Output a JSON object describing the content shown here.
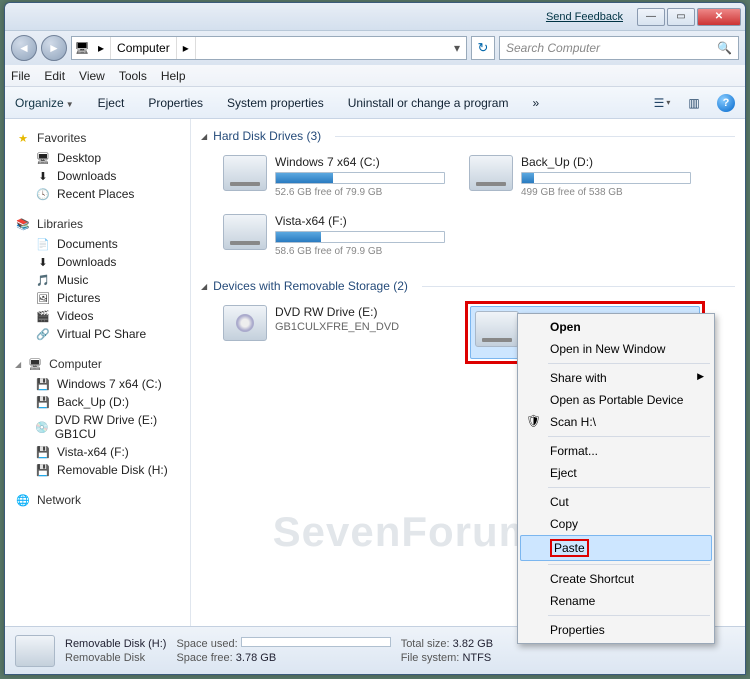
{
  "titlebar": {
    "feedback": "Send Feedback"
  },
  "address": {
    "crumb": "Computer",
    "arrow": "▸"
  },
  "search": {
    "placeholder": "Search Computer"
  },
  "menubar": [
    "File",
    "Edit",
    "View",
    "Tools",
    "Help"
  ],
  "toolbar": {
    "organize": "Organize",
    "items": [
      "Eject",
      "Properties",
      "System properties",
      "Uninstall or change a program"
    ],
    "overflow": "»"
  },
  "sidebar": {
    "favorites": {
      "label": "Favorites",
      "items": [
        "Desktop",
        "Downloads",
        "Recent Places"
      ]
    },
    "libraries": {
      "label": "Libraries",
      "items": [
        "Documents",
        "Downloads",
        "Music",
        "Pictures",
        "Videos",
        "Virtual PC Share"
      ]
    },
    "computer": {
      "label": "Computer",
      "items": [
        "Windows 7 x64 (C:)",
        "Back_Up (D:)",
        "DVD RW Drive (E:) GB1CU",
        "Vista-x64 (F:)",
        "Removable Disk (H:)"
      ]
    },
    "network": {
      "label": "Network"
    }
  },
  "groups": {
    "hdd": {
      "label": "Hard Disk Drives (3)"
    },
    "rem": {
      "label": "Devices with Removable Storage (2)"
    }
  },
  "drives": {
    "c": {
      "name": "Windows 7 x64 (C:)",
      "free": "52.6 GB free of 79.9 GB",
      "pct": 34
    },
    "d": {
      "name": "Back_Up (D:)",
      "free": "499 GB free of 538 GB",
      "pct": 7
    },
    "f": {
      "name": "Vista-x64 (F:)",
      "free": "58.6 GB free of 79.9 GB",
      "pct": 27
    },
    "e": {
      "name": "DVD RW Drive (E:)",
      "sub": "GB1CULXFRE_EN_DVD"
    },
    "h": {
      "name": "Removable Disk (H:)",
      "free": "3.78 GB free of 3.82 GB",
      "pct": 2
    }
  },
  "context": {
    "open": "Open",
    "newwin": "Open in New Window",
    "share": "Share with",
    "portable": "Open as Portable Device",
    "scan": "Scan H:\\",
    "format": "Format...",
    "eject": "Eject",
    "cut": "Cut",
    "copy": "Copy",
    "paste": "Paste",
    "shortcut": "Create Shortcut",
    "rename": "Rename",
    "props": "Properties"
  },
  "status": {
    "name": "Removable Disk (H:)",
    "sub": "Removable Disk",
    "used_lbl": "Space used:",
    "free_lbl": "Space free:",
    "free_val": "3.78 GB",
    "total_lbl": "Total size:",
    "total_val": "3.82 GB",
    "fs_lbl": "File system:",
    "fs_val": "NTFS"
  },
  "watermark": "SevenForums.com"
}
